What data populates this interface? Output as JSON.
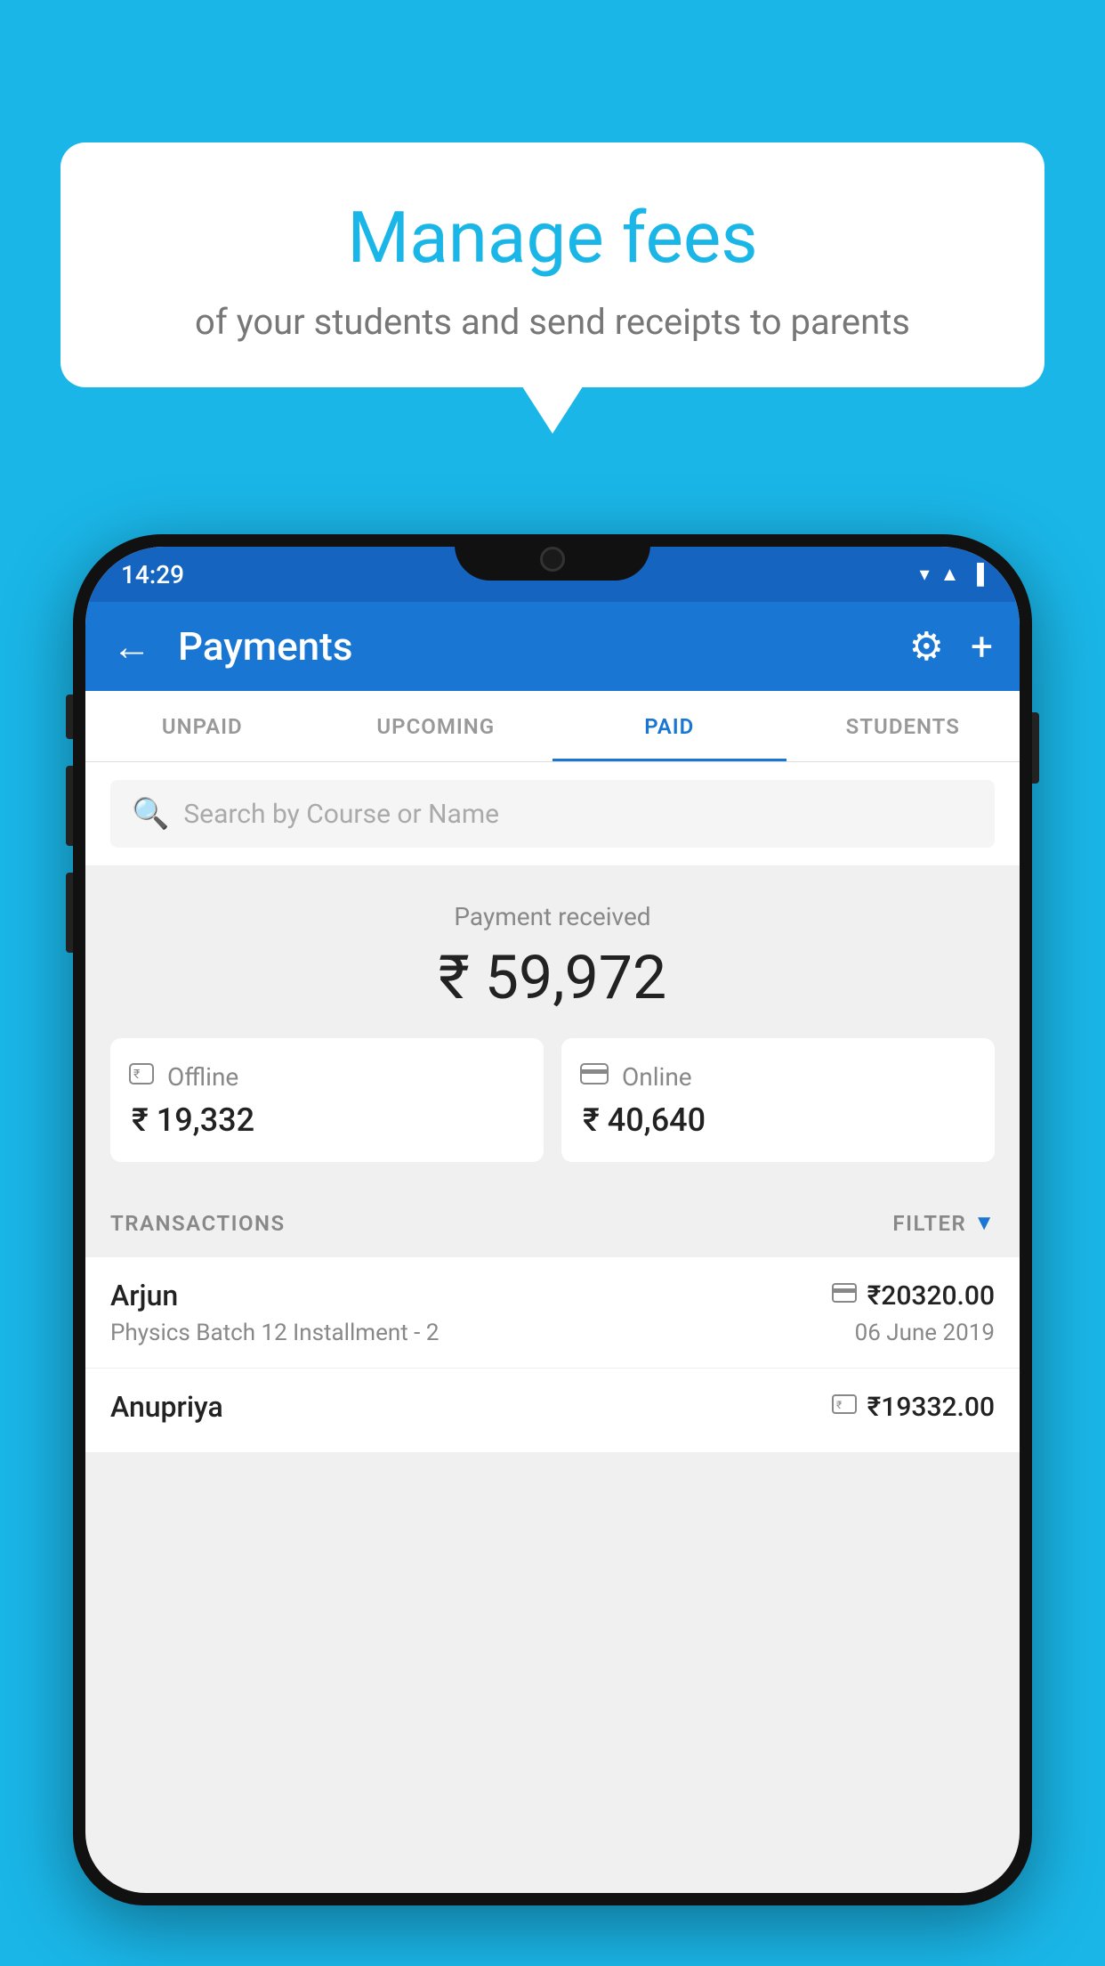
{
  "background_color": "#1ab6e8",
  "speech_bubble": {
    "title": "Manage fees",
    "subtitle": "of your students and send receipts to parents"
  },
  "status_bar": {
    "time": "14:29",
    "icons": [
      "wifi",
      "signal",
      "battery"
    ]
  },
  "app_bar": {
    "title": "Payments",
    "back_icon": "←",
    "settings_icon": "⚙",
    "add_icon": "+"
  },
  "tabs": [
    {
      "label": "UNPAID",
      "active": false
    },
    {
      "label": "UPCOMING",
      "active": false
    },
    {
      "label": "PAID",
      "active": true
    },
    {
      "label": "STUDENTS",
      "active": false
    }
  ],
  "search": {
    "placeholder": "Search by Course or Name"
  },
  "payment_summary": {
    "received_label": "Payment received",
    "amount": "₹ 59,972",
    "offline_label": "Offline",
    "offline_amount": "₹ 19,332",
    "online_label": "Online",
    "online_amount": "₹ 40,640"
  },
  "transactions": {
    "section_label": "TRANSACTIONS",
    "filter_label": "FILTER",
    "rows": [
      {
        "name": "Arjun",
        "amount": "₹20320.00",
        "course": "Physics Batch 12 Installment - 2",
        "date": "06 June 2019",
        "payment_type": "card"
      },
      {
        "name": "Anupriya",
        "amount": "₹19332.00",
        "course": "",
        "date": "",
        "payment_type": "offline"
      }
    ]
  }
}
